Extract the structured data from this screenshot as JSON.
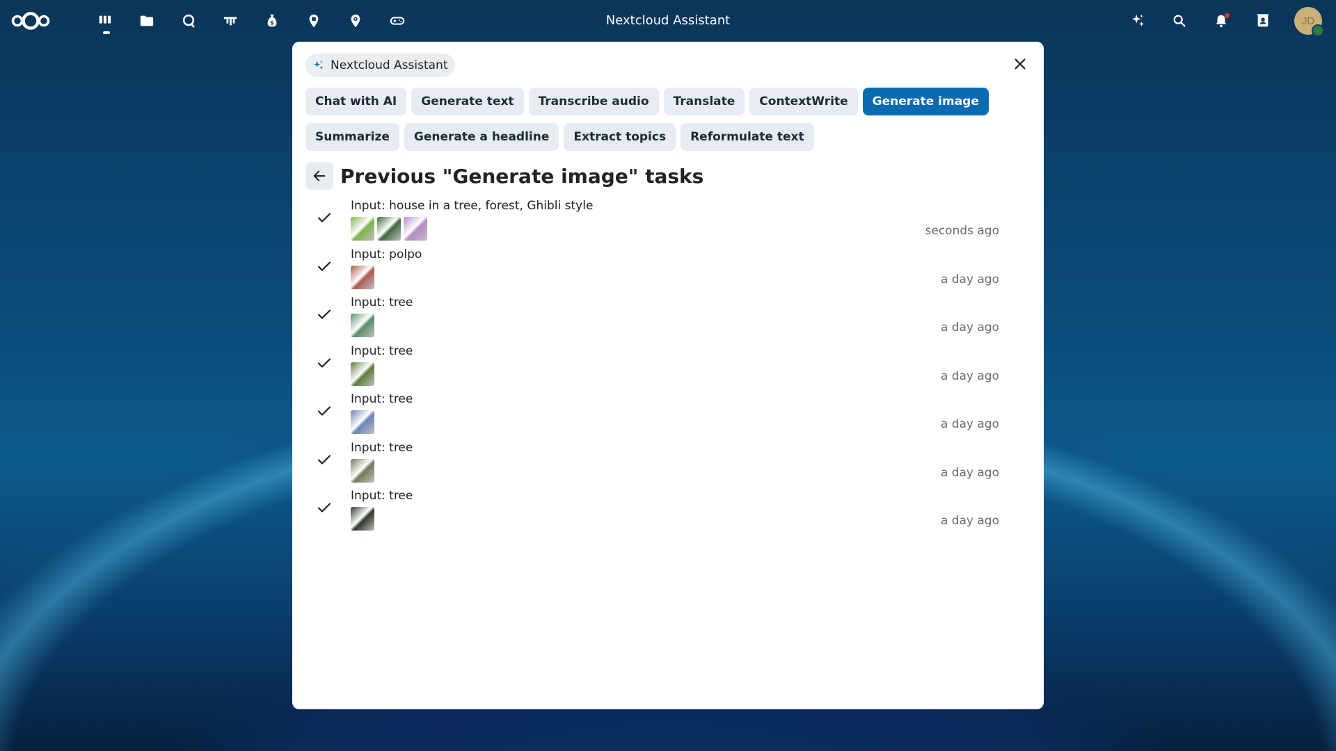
{
  "topbar": {
    "title": "Nextcloud Assistant",
    "apps": [
      {
        "name": "dashboard",
        "icon": "dashboard-icon",
        "active": true
      },
      {
        "name": "files",
        "icon": "folder-icon"
      },
      {
        "name": "talk",
        "icon": "chat-bubble-icon"
      },
      {
        "name": "deck",
        "icon": "deck-icon"
      },
      {
        "name": "cospend",
        "icon": "money-bag-icon"
      },
      {
        "name": "maps",
        "icon": "map-pin-icon"
      },
      {
        "name": "maps-2",
        "icon": "location-icon"
      },
      {
        "name": "tasks",
        "icon": "game-icon"
      }
    ],
    "right_icons": [
      "assistant-sparkle-icon",
      "search-icon",
      "notifications-bell-icon",
      "contacts-icon"
    ],
    "avatar_initials": "JD"
  },
  "modal": {
    "chip_label": "Nextcloud Assistant",
    "tabs": [
      {
        "label": "Chat with AI",
        "active": false
      },
      {
        "label": "Generate text",
        "active": false
      },
      {
        "label": "Transcribe audio",
        "active": false
      },
      {
        "label": "Translate",
        "active": false
      },
      {
        "label": "ContextWrite",
        "active": false
      },
      {
        "label": "Generate image",
        "active": true
      },
      {
        "label": "Summarize",
        "active": false
      },
      {
        "label": "Generate a headline",
        "active": false
      },
      {
        "label": "Extract topics",
        "active": false
      },
      {
        "label": "Reformulate text",
        "active": false
      }
    ],
    "section_title": "Previous \"Generate image\" tasks",
    "tasks": [
      {
        "input": "Input: house in a tree, forest, Ghibli style",
        "time": "seconds ago",
        "thumbs": [
          "#7fb24a",
          "#3f6a3a",
          "#b48bc8"
        ]
      },
      {
        "input": "Input: polpo",
        "time": "a day ago",
        "thumbs": [
          "#b05a4e"
        ]
      },
      {
        "input": "Input: tree",
        "time": "a day ago",
        "thumbs": [
          "#5b8f67"
        ]
      },
      {
        "input": "Input: tree",
        "time": "a day ago",
        "thumbs": [
          "#5e7f3c"
        ]
      },
      {
        "input": "Input: tree",
        "time": "a day ago",
        "thumbs": [
          "#6d84b8"
        ]
      },
      {
        "input": "Input: tree",
        "time": "a day ago",
        "thumbs": [
          "#6f7a58"
        ]
      },
      {
        "input": "Input: tree",
        "time": "a day ago",
        "thumbs": [
          "#2e3a2a"
        ]
      }
    ]
  },
  "colors": {
    "accent": "#0a6bb3",
    "tab_bg": "#e6ecf2"
  }
}
